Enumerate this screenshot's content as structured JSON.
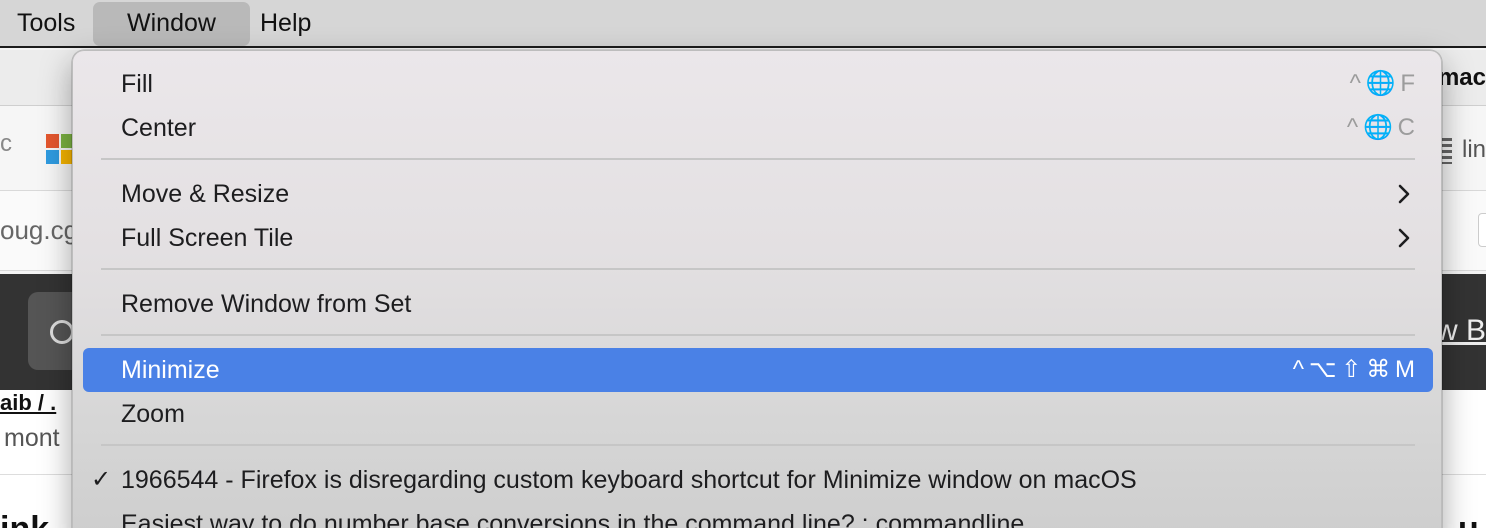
{
  "menubar": {
    "items": [
      {
        "label": "Tools"
      },
      {
        "label": "Window"
      },
      {
        "label": "Help"
      }
    ]
  },
  "background": {
    "tab_title_fragment": "mac",
    "bookmark_left_fragment": "c",
    "bookmark_right_fragment": "lin",
    "url_fragment": "oug.cg",
    "dark_band_right_fragment": "w B",
    "link_fragment": "aib / .",
    "time_fragment": "mont",
    "heading_left_fragment": "ink",
    "heading_right_fragment": "u"
  },
  "window_menu": {
    "items": [
      {
        "label": "Fill",
        "shortcut": "^ 🌐 F"
      },
      {
        "label": "Center",
        "shortcut": "^ 🌐 C"
      },
      {
        "label": "Move & Resize"
      },
      {
        "label": "Full Screen Tile"
      },
      {
        "label": "Remove Window from Set"
      },
      {
        "label": "Minimize",
        "shortcut": "^ ⌥ ⇧ ⌘ M"
      },
      {
        "label": "Zoom"
      },
      {
        "label": "1966544 - Firefox is disregarding custom keyboard shortcut for Minimize window on macOS",
        "checked": true,
        "check_mark": "✓"
      },
      {
        "label": "Easiest way to do number base conversions in the command line? : commandline"
      }
    ]
  },
  "colors": {
    "highlight": "#4a81e6",
    "menubar": "#d6d6d6",
    "shortcut_text": "#9c9c9c"
  }
}
